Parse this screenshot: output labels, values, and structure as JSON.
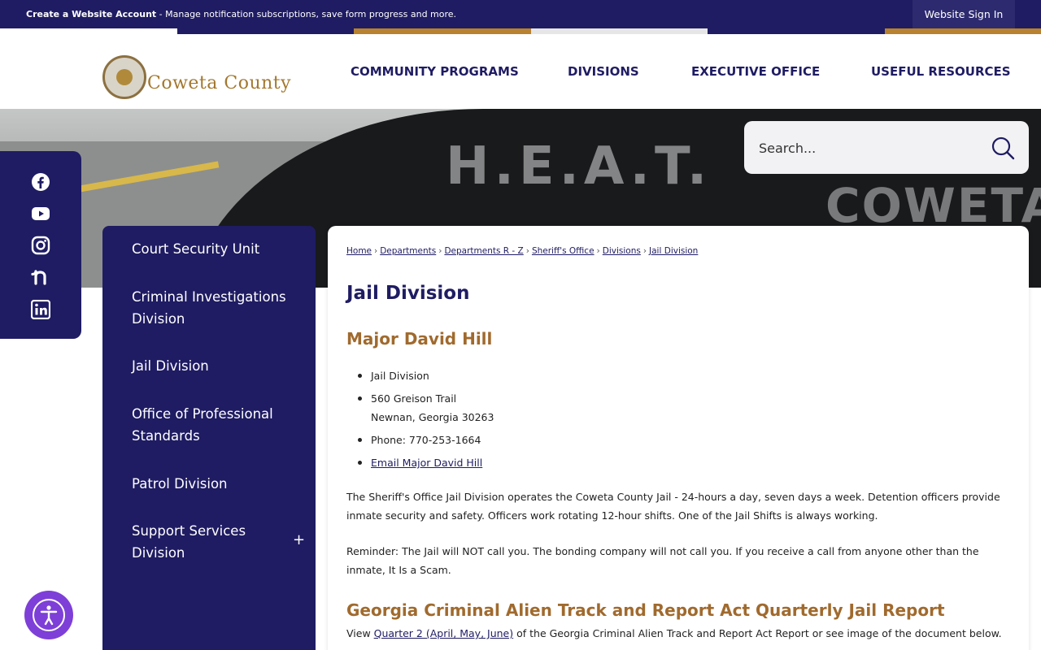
{
  "topbar": {
    "notice_bold": "Create a Website Account",
    "notice_rest": " - Manage notification subscriptions, save form progress and more.",
    "signin_label": "Website Sign In"
  },
  "colors": {
    "primary": "#1f1c63",
    "accent": "#a06a2e",
    "stripe_gold": "#b8822f",
    "a11y": "#7e3fd8"
  },
  "header": {
    "logo_text": "Coweta County",
    "nav": [
      "COMMUNITY PROGRAMS",
      "DIVISIONS",
      "EXECUTIVE OFFICE",
      "USEFUL RESOURCES"
    ]
  },
  "hero": {
    "decal_heat": "H.E.A.T.",
    "decal_coweta": "COWETA"
  },
  "search": {
    "placeholder": "Search..."
  },
  "social": [
    "facebook-icon",
    "youtube-icon",
    "instagram-icon",
    "nextdoor-icon",
    "linkedin-icon"
  ],
  "sidenav": {
    "items": [
      "Court Security Unit",
      "Criminal Investigations Division",
      "Jail Division",
      "Office of Professional Standards",
      "Patrol Division",
      "Support Services Division"
    ],
    "expand_symbol": "+"
  },
  "breadcrumb": [
    "Home",
    "Departments",
    "Departments R - Z",
    "Sheriff's Office",
    "Divisions",
    "Jail Division"
  ],
  "page": {
    "title": "Jail Division",
    "subhead": "Major David Hill",
    "info": {
      "division": "Jail Division",
      "address_line1": "560 Greison Trail",
      "address_line2": "Newnan, Georgia 30263",
      "phone": "Phone: 770-253-1664",
      "email_link": "Email Major David Hill"
    },
    "para1": "The Sheriff's Office Jail Division operates the Coweta County Jail - 24-hours a day, seven days a week. Detention officers provide inmate security and safety. Officers work rotating 12-hour shifts. One of the Jail Shifts is always working.",
    "para2": "Reminder: The Jail will NOT call you. The bonding company will not call you. If you receive a call from anyone other than the inmate, It Is a Scam.",
    "subhead2": "Georgia Criminal Alien Track and Report Act Quarterly Jail Report",
    "report_prefix": "View ",
    "report_link": "Quarter 2 (April, May, June)",
    "report_suffix": " of the Georgia Criminal Alien Track and Report Act Report or see image of the document below."
  }
}
